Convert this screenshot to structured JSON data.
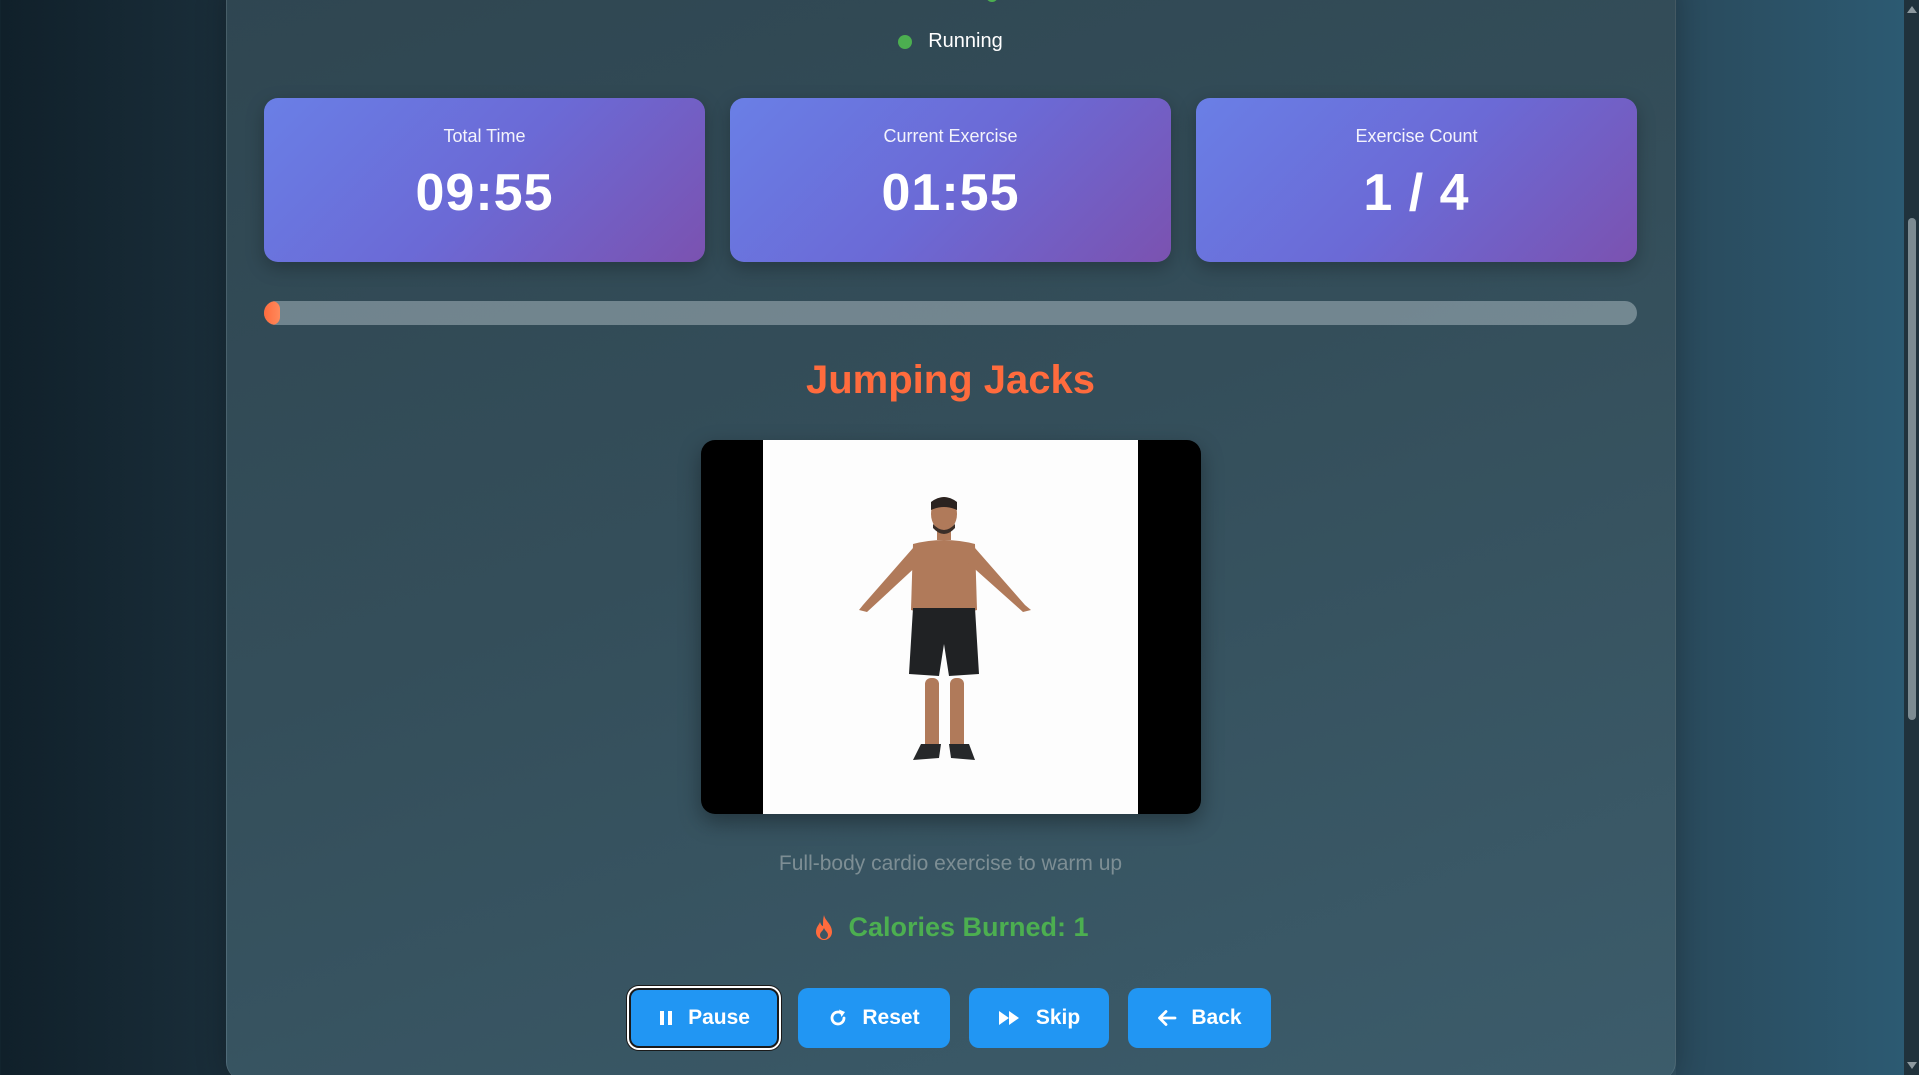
{
  "status": {
    "label": "Running",
    "color": "#4caf50"
  },
  "stats": [
    {
      "label": "Total Time",
      "value": "09:55"
    },
    {
      "label": "Current Exercise",
      "value": "01:55"
    },
    {
      "label": "Exercise Count",
      "value": "1 / 4"
    }
  ],
  "progress": {
    "fraction": 0.012,
    "color": "#ff6b3d"
  },
  "exercise": {
    "title": "Jumping Jacks",
    "description": "Full-body cardio exercise to warm up",
    "calories_label": "Calories Burned: 1"
  },
  "controls": {
    "pause_label": "Pause",
    "reset_label": "Reset",
    "skip_label": "Skip",
    "back_label": "Back"
  },
  "icons": {
    "pause": "pause-icon",
    "reset": "redo-icon",
    "skip": "fast-forward-icon",
    "back": "arrow-left-icon",
    "calories": "fire-icon"
  },
  "colors": {
    "accent": "#ff6b3d",
    "button": "#2196f3",
    "success": "#4caf50"
  }
}
